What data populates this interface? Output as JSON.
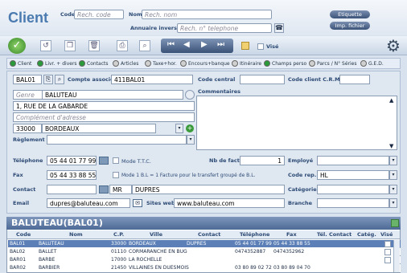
{
  "header": {
    "title": "Client",
    "code_label": "Code",
    "code_placeholder": "Rech. code",
    "nom_label": "Nom",
    "nom_placeholder": "Rech. nom",
    "annuaire_label": "Annuaire inversé",
    "annuaire_placeholder": "Rech. n° telephone",
    "etiquette_label": "Etiquette",
    "imp_fichier_label": "Imp. fichier",
    "vise_label": "Visé"
  },
  "tabs": [
    {
      "label": "Client",
      "color": "#2a9a3a"
    },
    {
      "label": "Livr. + divers",
      "color": "#2a9a3a"
    },
    {
      "label": "Contacts",
      "color": "#2a9a3a"
    },
    {
      "label": "Articles",
      "color": "#d0d0d0"
    },
    {
      "label": "Taxe+hor.",
      "color": "#d0d0d0"
    },
    {
      "label": "Encours+banque",
      "color": "#d0d0d0"
    },
    {
      "label": "Itinéraire",
      "color": "#d0d0d0"
    },
    {
      "label": "Champs perso",
      "color": "#2a9a3a"
    },
    {
      "label": "Parcs / N° Séries",
      "color": "#d0d0d0"
    },
    {
      "label": "G.E.D.",
      "color": "#d0d0d0"
    }
  ],
  "form": {
    "code_value": "BAL01",
    "compte_associe_label": "Compte associé",
    "compte_associe_value": "411BAL01",
    "code_central_label": "Code central",
    "code_client_crm_label": "Code client C.R.M.",
    "commentaires_label": "Commentaires",
    "genre_placeholder": "Genre",
    "genre_value": "BALUTEAU",
    "adresse_value": "1, RUE DE LA GABARDE",
    "complement_placeholder": "Complément d'adresse",
    "cp_value": "33000",
    "ville_value": "BORDEAUX",
    "reglement_label": "Règlement",
    "telephone_label": "Téléphone",
    "telephone_value": "05 44 01 77 99",
    "mode_ttc_label": "Mode T.T.C.",
    "nb_factures_label": "Nb de factures",
    "nb_factures_value": "1",
    "employe_label": "Employé",
    "fax_label": "Fax",
    "fax_value": "05 44 33 88 55",
    "mode_bl_label": "Mode 1 B.L = 1 Facture pour le transfert groupé de B.L.",
    "code_rep_label": "Code rep.",
    "code_rep_value": "HL",
    "contact_label": "Contact",
    "contact_civ": "MR",
    "contact_nom": "DUPRES",
    "categorie_label": "Catégorie",
    "email_label": "Email",
    "email_value": "dupres@baluteau.com",
    "sites_web_label": "Sites web",
    "sites_web_value": "www.baluteau.com",
    "branche_label": "Branche"
  },
  "grid": {
    "title": "BALUTEAU(BAL01)",
    "columns": [
      "Code",
      "Nom",
      "C.P.",
      "Ville",
      "Contact",
      "Téléphone",
      "Fax",
      "Tél. Contact",
      "Catég.",
      "Visé"
    ],
    "rows": [
      [
        "BAL01",
        "BALUTEAU",
        "33000",
        "BORDEAUX",
        "DUPRES",
        "05 44 01 77 99",
        "05 44 33 88 55",
        "",
        "",
        ""
      ],
      [
        "BAL02",
        "BALLET",
        "01110",
        "CORMARANCHE EN BUG",
        "",
        "0474352887",
        "0474352962",
        "",
        "",
        ""
      ],
      [
        "BAR01",
        "BARBE",
        "17000",
        "LA ROCHELLE",
        "",
        "",
        "",
        "",
        "",
        ""
      ],
      [
        "BAR02",
        "BARBIER",
        "21450",
        "VILLAINES EN DUESMOIS",
        "",
        "03 80 89 02 72",
        "03 80 89 04 70",
        "",
        "",
        ""
      ]
    ]
  }
}
